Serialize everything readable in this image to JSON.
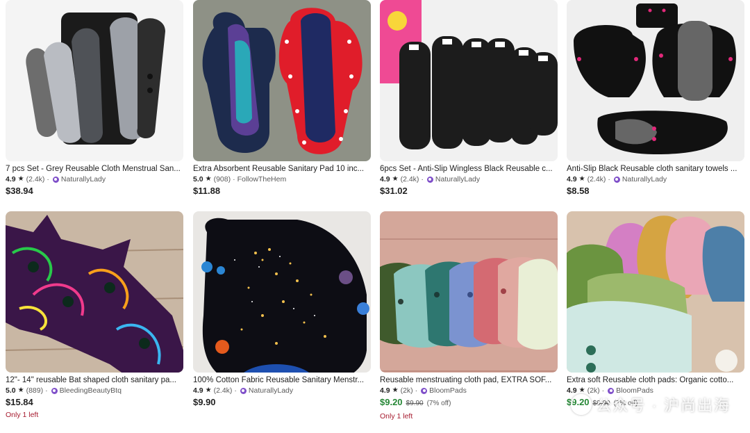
{
  "listings": [
    {
      "title": "7 pcs Set - Grey Reusable Cloth Menstrual San...",
      "rating": "4.9",
      "reviews": "(2.4k)",
      "shop": "NaturallyLady",
      "price": "$38.94"
    },
    {
      "title": "Extra Absorbent Reusable Sanitary Pad 10 inc...",
      "rating": "5.0",
      "reviews": "(908)",
      "shop": "FollowTheHem",
      "price": "$11.88"
    },
    {
      "title": "6pcs Set - Anti-Slip Wingless Black Reusable c...",
      "rating": "4.9",
      "reviews": "(2.4k)",
      "shop": "NaturallyLady",
      "price": "$31.02"
    },
    {
      "title": "Anti-Slip Black Reusable cloth sanitary towels ...",
      "rating": "4.9",
      "reviews": "(2.4k)",
      "shop": "NaturallyLady",
      "price": "$8.58"
    },
    {
      "title": "12\"- 14\" reusable Bat shaped cloth sanitary pa...",
      "rating": "5.0",
      "reviews": "(889)",
      "shop": "BleedingBeautyBtq",
      "price": "$15.84",
      "low_stock": "Only 1 left"
    },
    {
      "title": "100% Cotton Fabric Reusable Sanitary Menstr...",
      "rating": "4.9",
      "reviews": "(2.4k)",
      "shop": "NaturallyLady",
      "price": "$9.90"
    },
    {
      "title": "Reusable menstruating cloth pad, EXTRA SOF...",
      "rating": "4.9",
      "reviews": "(2k)",
      "shop": "BloomPads",
      "price": "$9.20",
      "original_price": "$9.90",
      "discount": "(7% off)",
      "low_stock": "Only 1 left"
    },
    {
      "title": "Extra soft Reusable cloth pads: Organic cotto...",
      "rating": "4.9",
      "reviews": "(2k)",
      "shop": "BloomPads",
      "price": "$9.20",
      "original_price": "$9.90",
      "discount": "(7% off)"
    }
  ],
  "favorite_icon": "heart-icon",
  "star_glyph": "★",
  "colors": {
    "sale_price": "#258635",
    "star_seller_badge": "#7f4fc9",
    "low_stock": "#a61a2e"
  },
  "watermark": "公众号 · 沪尚出海"
}
